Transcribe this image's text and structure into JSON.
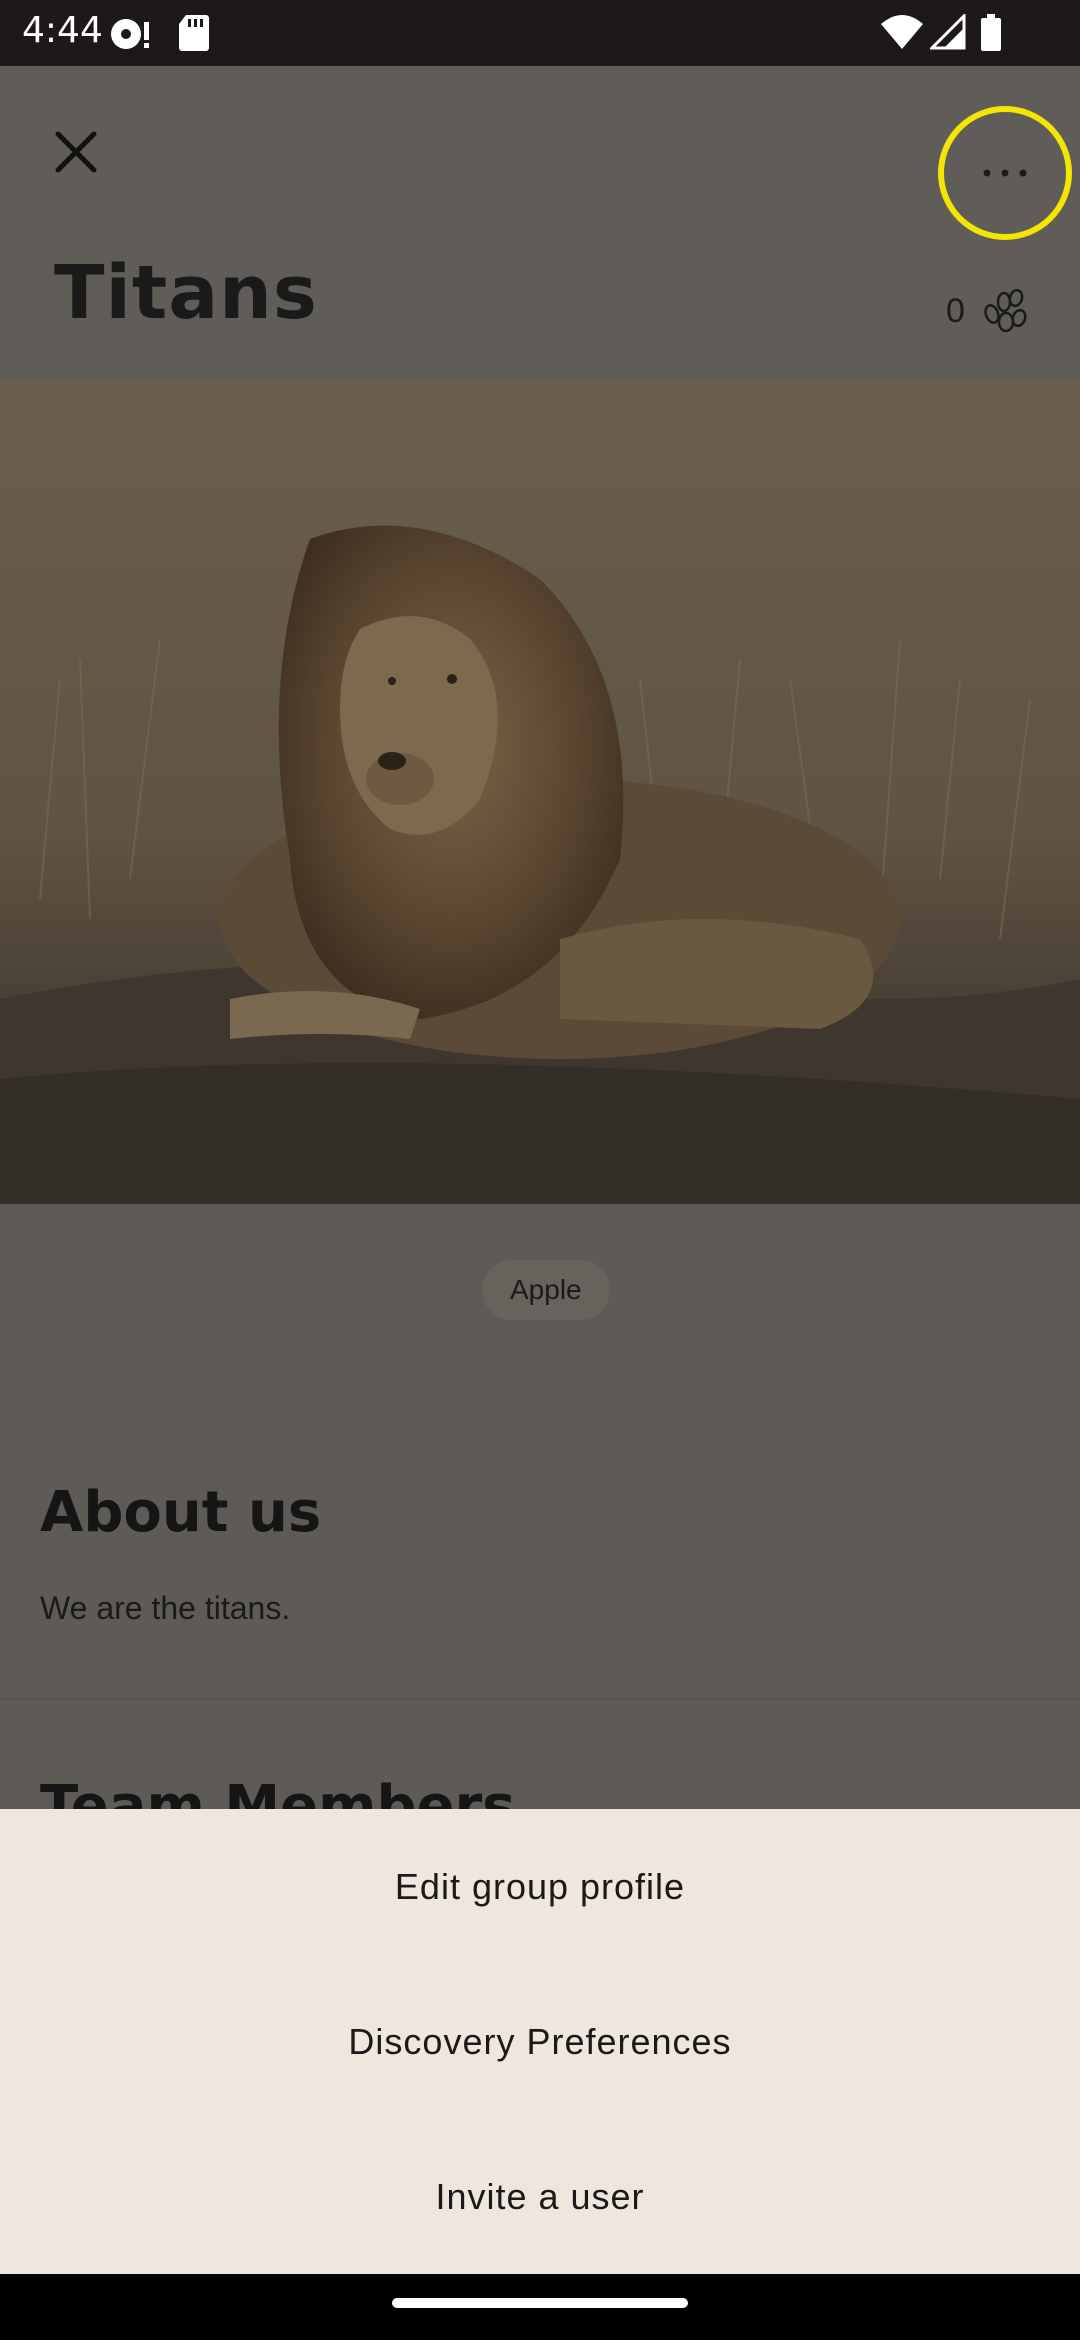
{
  "status_bar": {
    "time": "4:44"
  },
  "header": {
    "title": "Titans",
    "points": "0"
  },
  "hero_image": {
    "alt": "Lion resting in golden grass"
  },
  "tags": [
    "Apple"
  ],
  "about": {
    "title": "About us",
    "text": "We are the titans."
  },
  "team": {
    "title": "Team Members"
  },
  "sheet": {
    "items": [
      {
        "label": "Edit group profile"
      },
      {
        "label": "Discovery Preferences"
      },
      {
        "label": "Invite a user"
      }
    ]
  },
  "colors": {
    "highlight_ring": "#f3e600",
    "sheet_bg": "#efe7de",
    "scrim": "#5e5b57"
  },
  "icons": [
    "close-icon",
    "more-horizontal-icon",
    "paw-icon",
    "wifi-icon",
    "signal-icon",
    "battery-icon",
    "sd-card-icon",
    "notification-icon"
  ]
}
